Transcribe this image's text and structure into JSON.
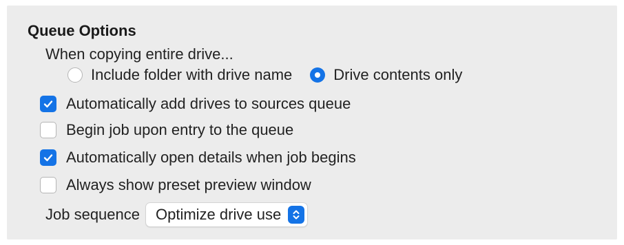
{
  "queue_options": {
    "title": "Queue Options",
    "copy_drive": {
      "label": "When copying entire drive...",
      "options": [
        {
          "label": "Include folder with drive name",
          "selected": false
        },
        {
          "label": "Drive contents only",
          "selected": true
        }
      ]
    },
    "checkboxes": [
      {
        "label": "Automatically add drives to sources queue",
        "checked": true
      },
      {
        "label": "Begin job upon entry to the queue",
        "checked": false
      },
      {
        "label": "Automatically open details when job begins",
        "checked": true
      },
      {
        "label": "Always show preset preview window",
        "checked": false
      }
    ],
    "job_sequence": {
      "label": "Job sequence",
      "value": "Optimize drive use"
    }
  },
  "colors": {
    "panel_background": "#ececec",
    "accent": "#1473e6"
  },
  "icons": {
    "checkmark": "checkmark-icon",
    "select_arrows": "chevron-up-down-icon"
  }
}
